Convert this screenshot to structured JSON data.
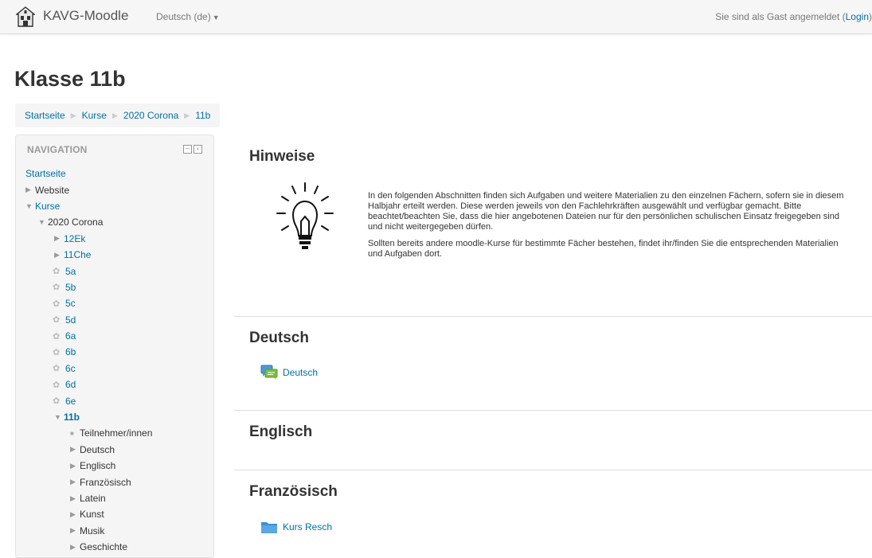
{
  "navbar": {
    "brand": "KAVG-Moodle",
    "language": "Deutsch (de)",
    "login_text": "Sie sind als Gast angemeldet (",
    "login_link": "Login",
    "login_close": ")"
  },
  "page": {
    "title": "Klasse 11b"
  },
  "breadcrumb": [
    "Startseite",
    "Kurse",
    "2020 Corona",
    "11b"
  ],
  "navigation": {
    "header": "NAVIGATION",
    "items": [
      "Startseite",
      "Website",
      "Kurse",
      "2020 Corona",
      "12Ek",
      "11Che",
      "5a",
      "5b",
      "5c",
      "5d",
      "6a",
      "6b",
      "6c",
      "6d",
      "6e",
      "11b",
      "Teilnehmer/innen",
      "Deutsch",
      "Englisch",
      "Französisch",
      "Latein",
      "Kunst",
      "Musik",
      "Geschichte"
    ]
  },
  "sections": {
    "hinweise": {
      "title": "Hinweise",
      "paragraph1": "In den folgenden Abschnitten finden sich Aufgaben und weitere Materialien zu den einzelnen Fächern, sofern sie in diesem Halbjahr erteilt werden. Diese werden jeweils von den Fachlehrkräften ausgewählt und verfügbar gemacht. Bitte beachtet/beachten Sie, dass die hier angebotenen Dateien nur für den persönlichen schulischen Einsatz freigegeben sind und nicht weitergegeben dürfen.",
      "paragraph2": "Sollten bereits andere moodle-Kurse für bestimmte Fächer bestehen, findet ihr/finden Sie die entsprechenden Materialien und Aufgaben dort."
    },
    "deutsch": {
      "title": "Deutsch",
      "activity": "Deutsch"
    },
    "englisch": {
      "title": "Englisch"
    },
    "franzoesisch": {
      "title": "Französisch",
      "activity": "Kurs Resch"
    }
  },
  "icons": {
    "forum": "forum-icon",
    "folder": "folder-icon",
    "lightbulb": "lightbulb-icon",
    "course": "course-icon"
  },
  "colors": {
    "link": "#0070a8",
    "folder": "#4a9ad8",
    "forum_green": "#7bbf3a"
  }
}
